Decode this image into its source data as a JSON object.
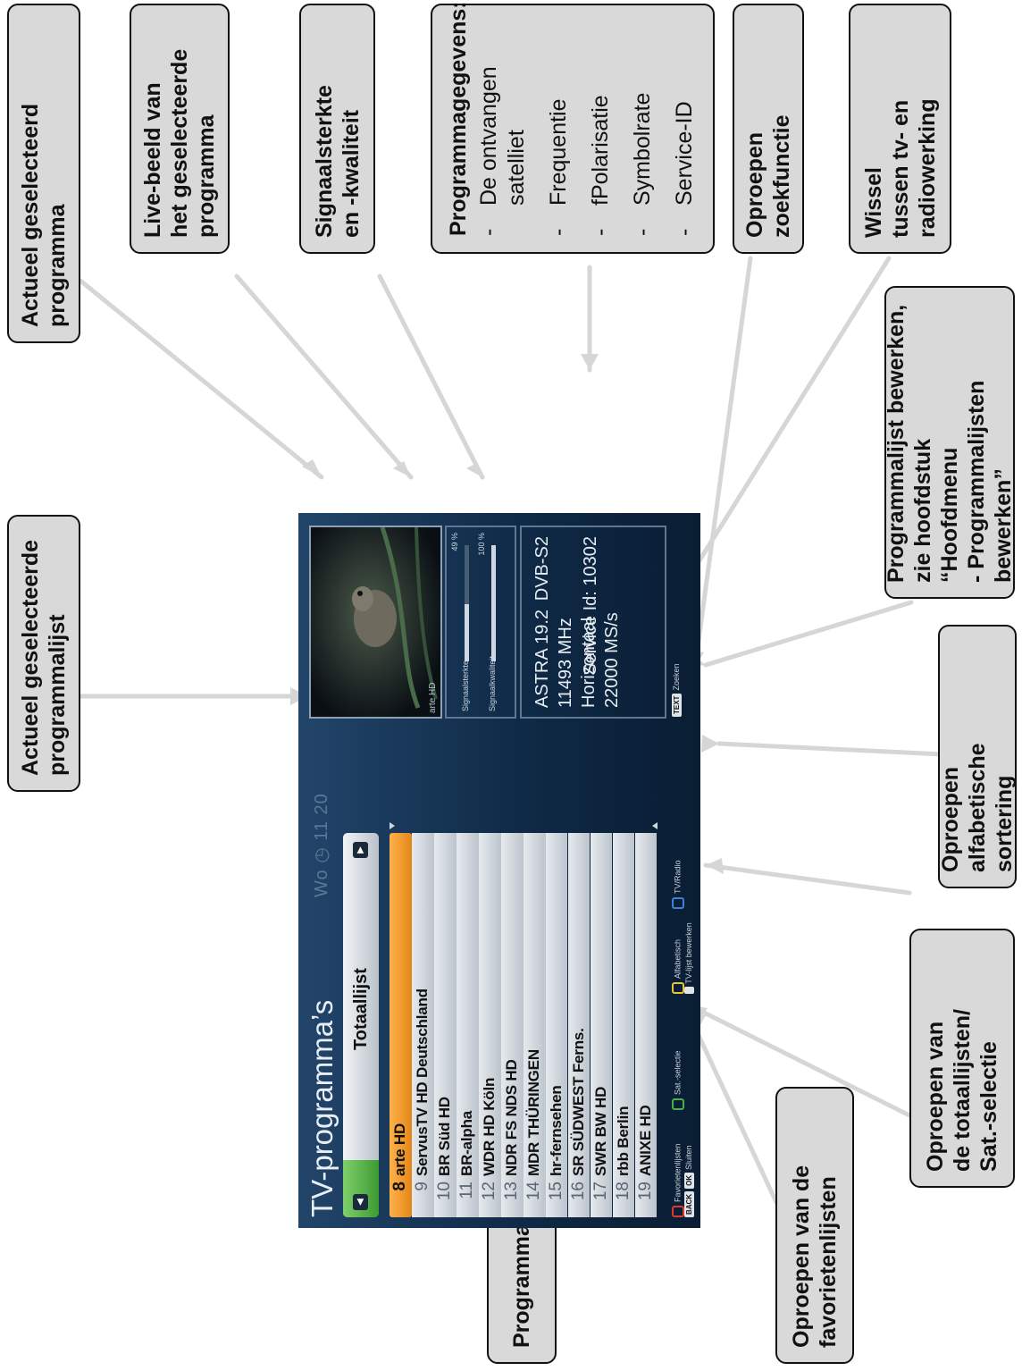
{
  "callouts": {
    "actueel_programma": "Actueel geselecteerd\nprogramma",
    "live_beeld": "Live-beeld van\nhet geselecteerde\nprogramma",
    "signaal": "Signaalsterkte\nen -kwaliteit",
    "programmagegevens": {
      "title": "Programmagegevens:",
      "items": [
        "De ontvangen\nsatelliet",
        "Frequentie",
        "fPolarisatie",
        "Symbolrate",
        "Service-ID"
      ]
    },
    "zoekfunctie": "Oproepen zoekfunctie",
    "wissel": "Wissel\ntussen tv- en\nradiowerking",
    "programmalijst_bewerken": "Programmalijst bewerken,\nzie hoofdstuk “Hoofdmenu\n- Programmalijsten\nbewerken”",
    "alfabetisch": "Oproepen\nalfabetische sortering",
    "totaallijsten": "Oproepen van\nde totaallijsten/\nSat.-selectie",
    "favorieten": "Oproepen van de\nfavorietenlijsten",
    "programmalijst": "Programmalijst",
    "actueel_lijst": "Actueel geselecteerde\nprogrammalijst"
  },
  "screen": {
    "title": "TV-programma’s",
    "clock": "Wo ◷ 11 20",
    "list_title": "Totaallijst",
    "channels": [
      {
        "num": "8",
        "name": "arte HD"
      },
      {
        "num": "9",
        "name": "ServusTV HD Deutschland"
      },
      {
        "num": "10",
        "name": "BR Süd HD"
      },
      {
        "num": "11",
        "name": "BR-alpha"
      },
      {
        "num": "12",
        "name": "WDR HD Köln"
      },
      {
        "num": "13",
        "name": "NDR FS NDS HD"
      },
      {
        "num": "14",
        "name": "MDR THÜRINGEN"
      },
      {
        "num": "15",
        "name": "hr-fernsehen"
      },
      {
        "num": "16",
        "name": "SR SÜDWEST Ferns."
      },
      {
        "num": "17",
        "name": "SWR BW HD"
      },
      {
        "num": "18",
        "name": "rbb Berlin"
      },
      {
        "num": "19",
        "name": "ANIXE HD"
      }
    ],
    "selected_channel_index": 0,
    "preview_caption": "arte HD",
    "signal": {
      "strength_label": "Signaalsterkte",
      "strength_value": "49 %",
      "strength_fraction": 0.49,
      "quality_label": "Signaalkwaliteit",
      "quality_value": "100 %",
      "quality_fraction": 1.0
    },
    "info": {
      "satellite": "ASTRA 19.2",
      "frequency": "11493 MHz",
      "polarisation": "Horizontaal",
      "symbolrate": "22000 MS/s",
      "standard": "DVB-S2",
      "service_id": "Service Id: 10302"
    },
    "footer": {
      "favorieten": "Favorietenlijsten",
      "sat_selectie": "Sat.-selectie",
      "alfabetisch": "Alfabetisch",
      "tv_radio": "TV/Radio",
      "zoeken": "Zoeken",
      "tv_lijst_bewerken": "TV-lijst bewerken",
      "sluiten": "Sluiten",
      "key_back": "BACK",
      "key_ok": "OK",
      "key_text": "TEXT"
    },
    "colors": {
      "red": "#e03a2f",
      "green": "#48b048",
      "yellow": "#e5c533",
      "blue": "#3f7fd6",
      "selected": "#f29a2a"
    }
  }
}
